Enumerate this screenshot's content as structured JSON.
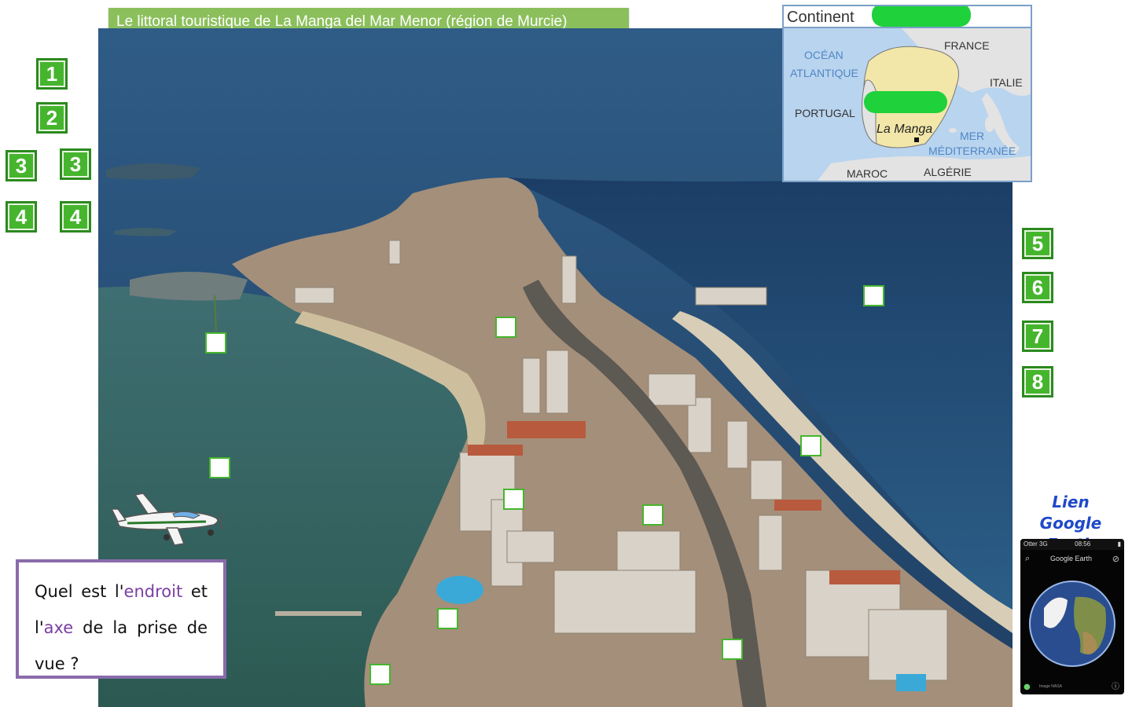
{
  "title": "Le littoral touristique de La Manga del Mar Menor (région de Murcie)",
  "number_labels": [
    "1",
    "2",
    "3",
    "3",
    "4",
    "4",
    "5",
    "6",
    "7",
    "8"
  ],
  "map": {
    "header": "Continent",
    "labels": {
      "france": "FRANCE",
      "ocean": "OCÉAN",
      "atlantique": "ATLANTIQUE",
      "italie": "ITALIE",
      "portugal": "PORTUGAL",
      "la_manga": "La Manga",
      "mer": "MER",
      "mediterranee": "MÉDITERRANÉE",
      "maroc": "MAROC",
      "algerie": "ALGÉRIE"
    }
  },
  "question": {
    "part1": "Quel est l'",
    "word1": "endroit",
    "part2": " et l'",
    "word2": "axe",
    "part3": " de la prise de vue ?"
  },
  "google_earth": {
    "line1": "Lien",
    "line2": "Google Earth",
    "status_left": "Otter 3G",
    "status_time": "08:56",
    "app_title": "Google Earth",
    "small_text": "Image NASA"
  },
  "colors": {
    "banner": "#8bbf5c",
    "label_green": "#46b52e",
    "question_border": "#8a6bab",
    "highlight_purple": "#7b3fa2",
    "link_blue": "#1e49c9"
  }
}
